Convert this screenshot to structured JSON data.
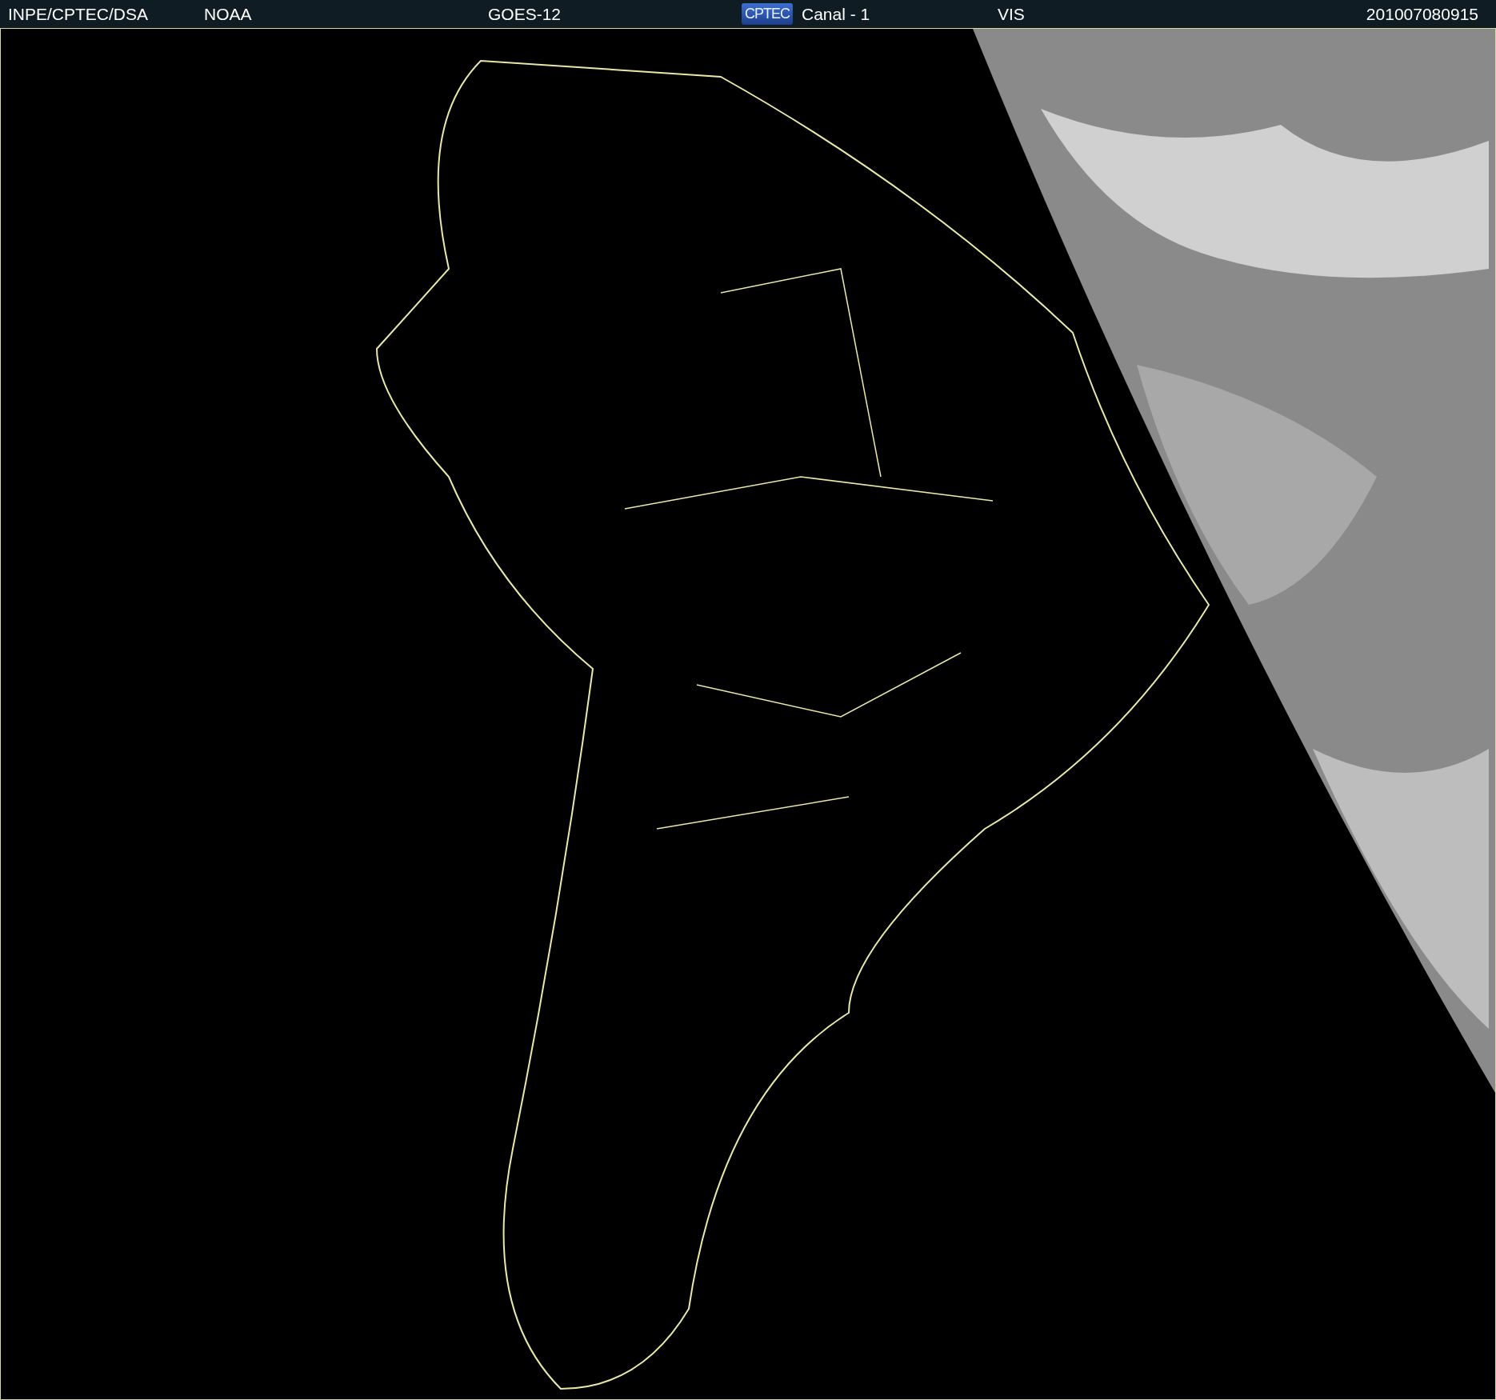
{
  "header": {
    "source": "INPE/CPTEC/DSA",
    "agency": "NOAA",
    "satellite": "GOES-12",
    "logo": "CPTEC",
    "channel": "Canal - 1",
    "band": "VIS",
    "timestamp": "201007080915"
  }
}
